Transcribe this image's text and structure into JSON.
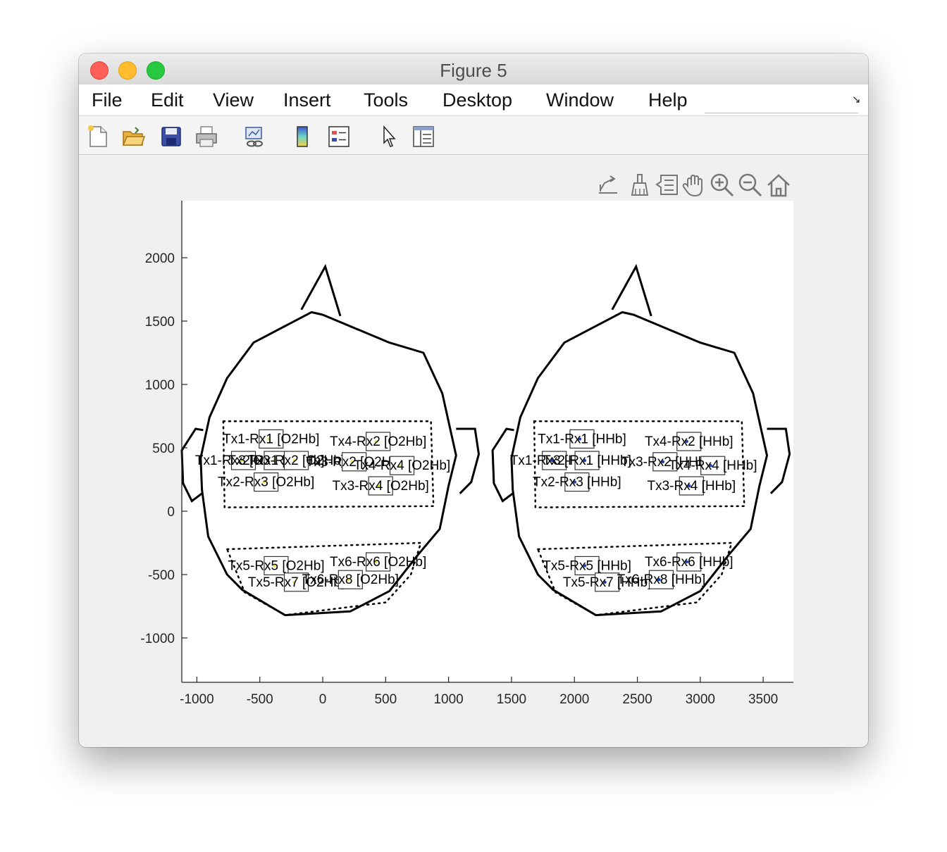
{
  "window": {
    "title": "Figure 5"
  },
  "menu": {
    "items": [
      "File",
      "Edit",
      "View",
      "Insert",
      "Tools",
      "Desktop",
      "Window",
      "Help"
    ]
  },
  "toolbar": {
    "icons": [
      "new-figure-icon",
      "open-file-icon",
      "save-icon",
      "print-icon",
      "link-plot-icon",
      "colorbar-icon",
      "legend-icon",
      "pointer-icon",
      "property-inspector-icon"
    ]
  },
  "axes_toolbar": {
    "icons": [
      "export-icon",
      "brush-icon",
      "data-tips-icon",
      "pan-icon",
      "zoom-in-icon",
      "zoom-out-icon",
      "home-icon"
    ]
  },
  "chart_data": {
    "type": "scatter",
    "title": "",
    "xlabel": "",
    "ylabel": "",
    "xlim": [
      -1120,
      3740
    ],
    "ylim": [
      -1350,
      2450
    ],
    "xticks": [
      -1000,
      -500,
      0,
      500,
      1000,
      1500,
      2000,
      2500,
      3000,
      3500
    ],
    "yticks": [
      -1000,
      -500,
      0,
      500,
      1000,
      1500,
      2000
    ],
    "grid": false,
    "heads": [
      {
        "outline": [
          [
            -90,
            1570
          ],
          [
            -550,
            1330
          ],
          [
            -760,
            1050
          ],
          [
            -900,
            740
          ],
          [
            -970,
            420
          ],
          [
            -960,
            170
          ],
          [
            -910,
            -200
          ],
          [
            -760,
            -500
          ],
          [
            -640,
            -620
          ],
          [
            -300,
            -820
          ],
          [
            220,
            -790
          ],
          [
            530,
            -630
          ],
          [
            760,
            -340
          ],
          [
            930,
            -140
          ],
          [
            1000,
            200
          ],
          [
            1060,
            440
          ],
          [
            950,
            930
          ],
          [
            800,
            1250
          ],
          [
            530,
            1330
          ],
          [
            0,
            1550
          ]
        ],
        "nose": [
          [
            -170,
            1590
          ],
          [
            20,
            1930
          ],
          [
            140,
            1540
          ]
        ],
        "left_ear": [
          [
            -950,
            640
          ],
          [
            -1010,
            650
          ],
          [
            -1120,
            480
          ],
          [
            -1110,
            220
          ],
          [
            -1040,
            80
          ],
          [
            -960,
            140
          ]
        ],
        "right_ear": [
          [
            1060,
            650
          ],
          [
            1210,
            650
          ],
          [
            1240,
            450
          ],
          [
            1180,
            230
          ],
          [
            1090,
            140
          ]
        ],
        "front_region": [
          [
            -790,
            710
          ],
          [
            860,
            710
          ],
          [
            880,
            40
          ],
          [
            -780,
            30
          ]
        ],
        "back_region": [
          [
            -760,
            -300
          ],
          [
            780,
            -250
          ],
          [
            700,
            -500
          ],
          [
            500,
            -720
          ],
          [
            -300,
            -820
          ],
          [
            -620,
            -640
          ],
          [
            -760,
            -300
          ]
        ]
      },
      {
        "outline": [
          [
            2380,
            1570
          ],
          [
            1920,
            1330
          ],
          [
            1710,
            1050
          ],
          [
            1570,
            740
          ],
          [
            1500,
            420
          ],
          [
            1510,
            170
          ],
          [
            1560,
            -200
          ],
          [
            1710,
            -500
          ],
          [
            1830,
            -620
          ],
          [
            2170,
            -820
          ],
          [
            2690,
            -790
          ],
          [
            3000,
            -630
          ],
          [
            3230,
            -340
          ],
          [
            3400,
            -140
          ],
          [
            3470,
            200
          ],
          [
            3530,
            440
          ],
          [
            3420,
            930
          ],
          [
            3270,
            1250
          ],
          [
            3000,
            1330
          ],
          [
            2470,
            1550
          ]
        ],
        "nose": [
          [
            2300,
            1590
          ],
          [
            2490,
            1930
          ],
          [
            2610,
            1540
          ]
        ],
        "left_ear": [
          [
            1520,
            640
          ],
          [
            1460,
            650
          ],
          [
            1350,
            480
          ],
          [
            1360,
            220
          ],
          [
            1430,
            80
          ],
          [
            1510,
            140
          ]
        ],
        "right_ear": [
          [
            3530,
            650
          ],
          [
            3680,
            650
          ],
          [
            3710,
            450
          ],
          [
            3650,
            230
          ],
          [
            3560,
            140
          ]
        ],
        "front_region": [
          [
            1680,
            710
          ],
          [
            3330,
            710
          ],
          [
            3350,
            40
          ],
          [
            1690,
            30
          ]
        ],
        "back_region": [
          [
            1710,
            -300
          ],
          [
            3250,
            -250
          ],
          [
            3170,
            -500
          ],
          [
            2970,
            -720
          ],
          [
            2170,
            -820
          ],
          [
            1850,
            -640
          ],
          [
            1710,
            -300
          ]
        ]
      }
    ],
    "channels": [
      {
        "label": "Tx1-Rx1 [O2Hb]",
        "x": -410,
        "y": 570
      },
      {
        "label": "Tx4-Rx2 [O2Hb]",
        "x": 440,
        "y": 550
      },
      {
        "label": "Tx1-Rx3 [O2Hb]",
        "x": -630,
        "y": 400
      },
      {
        "label": "Tx2-Rx1 [O2Hb]",
        "x": -370,
        "y": 400
      },
      {
        "label": "Tx3-Rx2 [O2Hb]",
        "x": -210,
        "y": 400
      },
      {
        "label": "Tx3-Rx2 [O2Hb]",
        "x": 250,
        "y": 390
      },
      {
        "label": "Tx4-Rx4 [O2Hb]",
        "x": 630,
        "y": 360
      },
      {
        "label": "Tx2-Rx3 [O2Hb]",
        "x": -450,
        "y": 230
      },
      {
        "label": "Tx3-Rx4 [O2Hb]",
        "x": 460,
        "y": 200
      },
      {
        "label": "Tx5-Rx5 [O2Hb]",
        "x": -370,
        "y": 480,
        "region": "back",
        "yb": -430
      },
      {
        "label": "Tx6-Rx6 [O2Hb]",
        "x": 440,
        "y": -400
      },
      {
        "label": "Tx5-Rx7 [O2Hb]",
        "x": -210,
        "y": -560
      },
      {
        "label": "Tx6-Rx8 [O2Hb]",
        "x": 220,
        "y": -540
      },
      {
        "label": "Tx1-Rx1 [HHb]",
        "x": 2060,
        "y": 570
      },
      {
        "label": "Tx4-Rx2 [HHb]",
        "x": 2910,
        "y": 550
      },
      {
        "label": "Tx1-Rx3 [HHb]",
        "x": 1840,
        "y": 400
      },
      {
        "label": "Tx2-Rx1 [HHb]",
        "x": 2100,
        "y": 400
      },
      {
        "label": "Tx3-Rx2 [HHb]",
        "x": 2720,
        "y": 390
      },
      {
        "label": "Tx4-Rx4 [HHb]",
        "x": 3100,
        "y": 360
      },
      {
        "label": "Tx2-Rx3 [HHb]",
        "x": 2020,
        "y": 230
      },
      {
        "label": "Tx3-Rx4 [HHb]",
        "x": 2930,
        "y": 200
      },
      {
        "label": "Tx5-Rx5 [HHb]",
        "x": 2100,
        "y": -430
      },
      {
        "label": "Tx6-Rx6 [HHb]",
        "x": 2910,
        "y": -400
      },
      {
        "label": "Tx5-Rx7 [HHb]",
        "x": 2260,
        "y": -560
      },
      {
        "label": "Tx6-Rx8 [HHb]",
        "x": 2690,
        "y": -540
      }
    ]
  }
}
